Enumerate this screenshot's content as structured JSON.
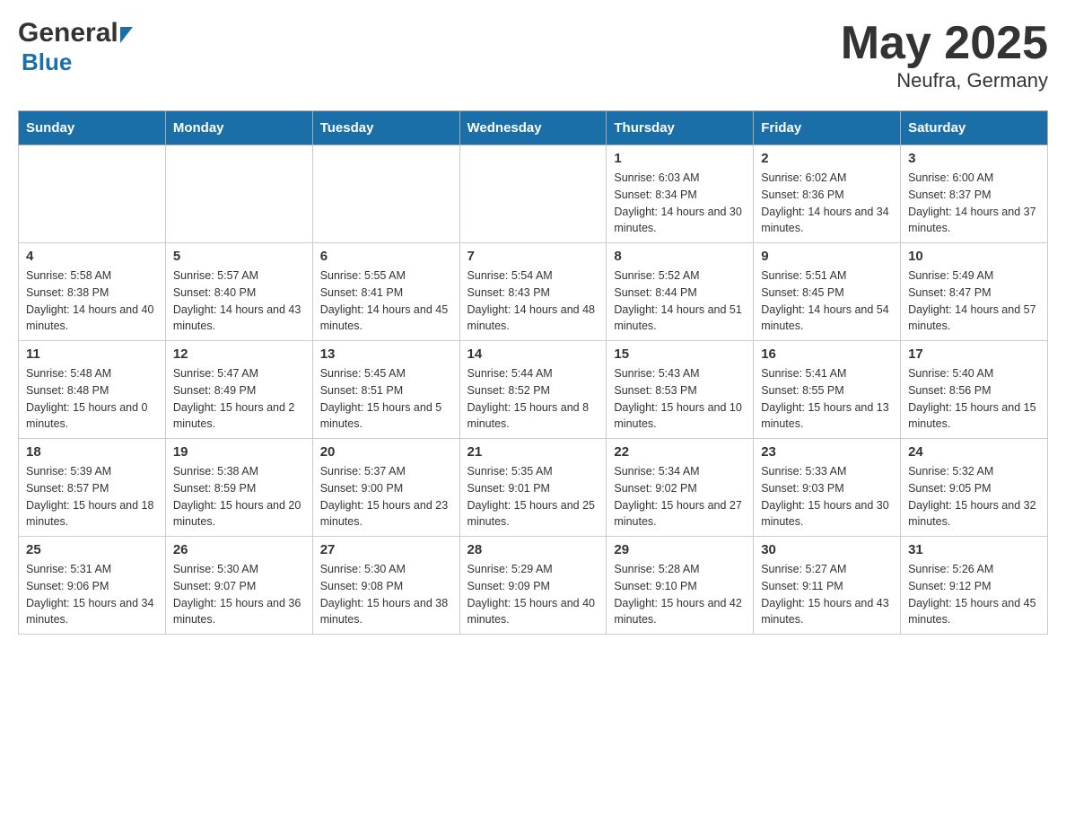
{
  "header": {
    "title": "May 2025",
    "subtitle": "Neufra, Germany"
  },
  "logo": {
    "general": "General",
    "blue": "Blue"
  },
  "weekdays": [
    "Sunday",
    "Monday",
    "Tuesday",
    "Wednesday",
    "Thursday",
    "Friday",
    "Saturday"
  ],
  "weeks": [
    [
      {
        "day": "",
        "info": ""
      },
      {
        "day": "",
        "info": ""
      },
      {
        "day": "",
        "info": ""
      },
      {
        "day": "",
        "info": ""
      },
      {
        "day": "1",
        "info": "Sunrise: 6:03 AM\nSunset: 8:34 PM\nDaylight: 14 hours and 30 minutes."
      },
      {
        "day": "2",
        "info": "Sunrise: 6:02 AM\nSunset: 8:36 PM\nDaylight: 14 hours and 34 minutes."
      },
      {
        "day": "3",
        "info": "Sunrise: 6:00 AM\nSunset: 8:37 PM\nDaylight: 14 hours and 37 minutes."
      }
    ],
    [
      {
        "day": "4",
        "info": "Sunrise: 5:58 AM\nSunset: 8:38 PM\nDaylight: 14 hours and 40 minutes."
      },
      {
        "day": "5",
        "info": "Sunrise: 5:57 AM\nSunset: 8:40 PM\nDaylight: 14 hours and 43 minutes."
      },
      {
        "day": "6",
        "info": "Sunrise: 5:55 AM\nSunset: 8:41 PM\nDaylight: 14 hours and 45 minutes."
      },
      {
        "day": "7",
        "info": "Sunrise: 5:54 AM\nSunset: 8:43 PM\nDaylight: 14 hours and 48 minutes."
      },
      {
        "day": "8",
        "info": "Sunrise: 5:52 AM\nSunset: 8:44 PM\nDaylight: 14 hours and 51 minutes."
      },
      {
        "day": "9",
        "info": "Sunrise: 5:51 AM\nSunset: 8:45 PM\nDaylight: 14 hours and 54 minutes."
      },
      {
        "day": "10",
        "info": "Sunrise: 5:49 AM\nSunset: 8:47 PM\nDaylight: 14 hours and 57 minutes."
      }
    ],
    [
      {
        "day": "11",
        "info": "Sunrise: 5:48 AM\nSunset: 8:48 PM\nDaylight: 15 hours and 0 minutes."
      },
      {
        "day": "12",
        "info": "Sunrise: 5:47 AM\nSunset: 8:49 PM\nDaylight: 15 hours and 2 minutes."
      },
      {
        "day": "13",
        "info": "Sunrise: 5:45 AM\nSunset: 8:51 PM\nDaylight: 15 hours and 5 minutes."
      },
      {
        "day": "14",
        "info": "Sunrise: 5:44 AM\nSunset: 8:52 PM\nDaylight: 15 hours and 8 minutes."
      },
      {
        "day": "15",
        "info": "Sunrise: 5:43 AM\nSunset: 8:53 PM\nDaylight: 15 hours and 10 minutes."
      },
      {
        "day": "16",
        "info": "Sunrise: 5:41 AM\nSunset: 8:55 PM\nDaylight: 15 hours and 13 minutes."
      },
      {
        "day": "17",
        "info": "Sunrise: 5:40 AM\nSunset: 8:56 PM\nDaylight: 15 hours and 15 minutes."
      }
    ],
    [
      {
        "day": "18",
        "info": "Sunrise: 5:39 AM\nSunset: 8:57 PM\nDaylight: 15 hours and 18 minutes."
      },
      {
        "day": "19",
        "info": "Sunrise: 5:38 AM\nSunset: 8:59 PM\nDaylight: 15 hours and 20 minutes."
      },
      {
        "day": "20",
        "info": "Sunrise: 5:37 AM\nSunset: 9:00 PM\nDaylight: 15 hours and 23 minutes."
      },
      {
        "day": "21",
        "info": "Sunrise: 5:35 AM\nSunset: 9:01 PM\nDaylight: 15 hours and 25 minutes."
      },
      {
        "day": "22",
        "info": "Sunrise: 5:34 AM\nSunset: 9:02 PM\nDaylight: 15 hours and 27 minutes."
      },
      {
        "day": "23",
        "info": "Sunrise: 5:33 AM\nSunset: 9:03 PM\nDaylight: 15 hours and 30 minutes."
      },
      {
        "day": "24",
        "info": "Sunrise: 5:32 AM\nSunset: 9:05 PM\nDaylight: 15 hours and 32 minutes."
      }
    ],
    [
      {
        "day": "25",
        "info": "Sunrise: 5:31 AM\nSunset: 9:06 PM\nDaylight: 15 hours and 34 minutes."
      },
      {
        "day": "26",
        "info": "Sunrise: 5:30 AM\nSunset: 9:07 PM\nDaylight: 15 hours and 36 minutes."
      },
      {
        "day": "27",
        "info": "Sunrise: 5:30 AM\nSunset: 9:08 PM\nDaylight: 15 hours and 38 minutes."
      },
      {
        "day": "28",
        "info": "Sunrise: 5:29 AM\nSunset: 9:09 PM\nDaylight: 15 hours and 40 minutes."
      },
      {
        "day": "29",
        "info": "Sunrise: 5:28 AM\nSunset: 9:10 PM\nDaylight: 15 hours and 42 minutes."
      },
      {
        "day": "30",
        "info": "Sunrise: 5:27 AM\nSunset: 9:11 PM\nDaylight: 15 hours and 43 minutes."
      },
      {
        "day": "31",
        "info": "Sunrise: 5:26 AM\nSunset: 9:12 PM\nDaylight: 15 hours and 45 minutes."
      }
    ]
  ]
}
